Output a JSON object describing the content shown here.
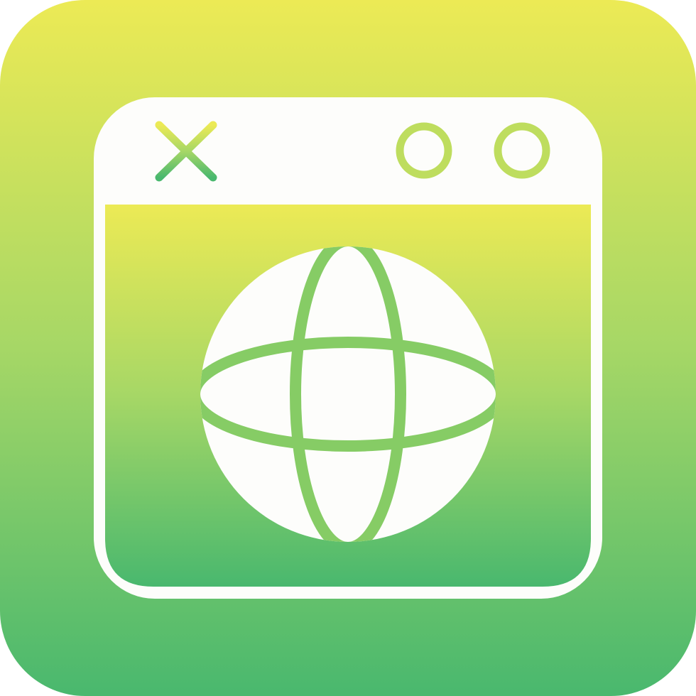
{
  "icon": {
    "name": "web-browser-globe-icon",
    "colors": {
      "gradient_top": "#ECEA55",
      "gradient_middle": "#A6D766",
      "gradient_bottom": "#49B86E",
      "foreground": "#FDFDFB"
    },
    "parts": [
      "browser-window-icon",
      "close-x-icon",
      "window-control-circle-icon",
      "globe-icon"
    ]
  }
}
